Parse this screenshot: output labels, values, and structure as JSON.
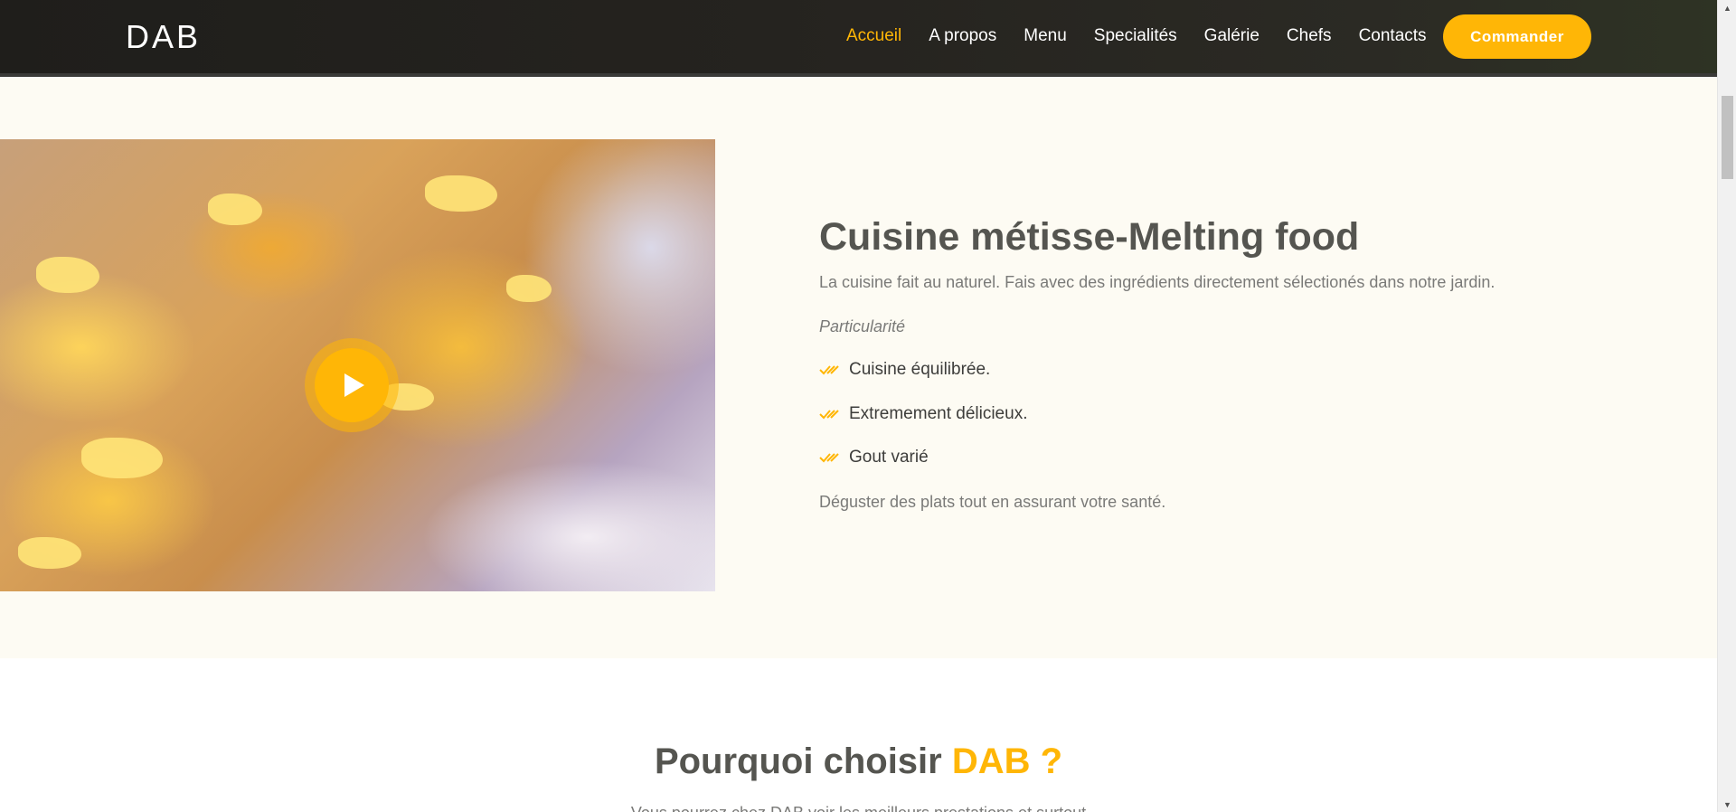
{
  "header": {
    "logo": "DAB",
    "nav": [
      {
        "label": "Accueil",
        "active": true
      },
      {
        "label": "A propos",
        "active": false
      },
      {
        "label": "Menu",
        "active": false
      },
      {
        "label": "Specialités",
        "active": false
      },
      {
        "label": "Galérie",
        "active": false
      },
      {
        "label": "Chefs",
        "active": false
      },
      {
        "label": "Contacts",
        "active": false
      }
    ],
    "order_label": "Commander"
  },
  "about": {
    "title_light": "Cuisine métisse-",
    "title_bold": "Melting food",
    "description": "La cuisine fait au naturel. Fais avec des ingrédients directement sélectionés dans notre jardin.",
    "subtitle": "Particularité",
    "features": [
      "Cuisine équilibrée.",
      "Extremement délicieux.",
      "Gout varié"
    ],
    "footer": "Déguster des plats tout en assurant votre santé."
  },
  "why": {
    "title_main": "Pourquoi choisir ",
    "title_accent": "DAB ?",
    "text": "Vous pourrez chez DAB voir les meilleurs prestations et surtout"
  },
  "colors": {
    "accent": "#ffb606",
    "header_bg": "#232220",
    "section_bg": "#fdfbf3",
    "heading": "#555550",
    "body_text": "#7a7a78"
  },
  "icons": {
    "play": "play-icon",
    "check": "double-check-icon",
    "scroll_up": "scroll-up-arrow-icon",
    "scroll_down": "scroll-down-arrow-icon"
  }
}
